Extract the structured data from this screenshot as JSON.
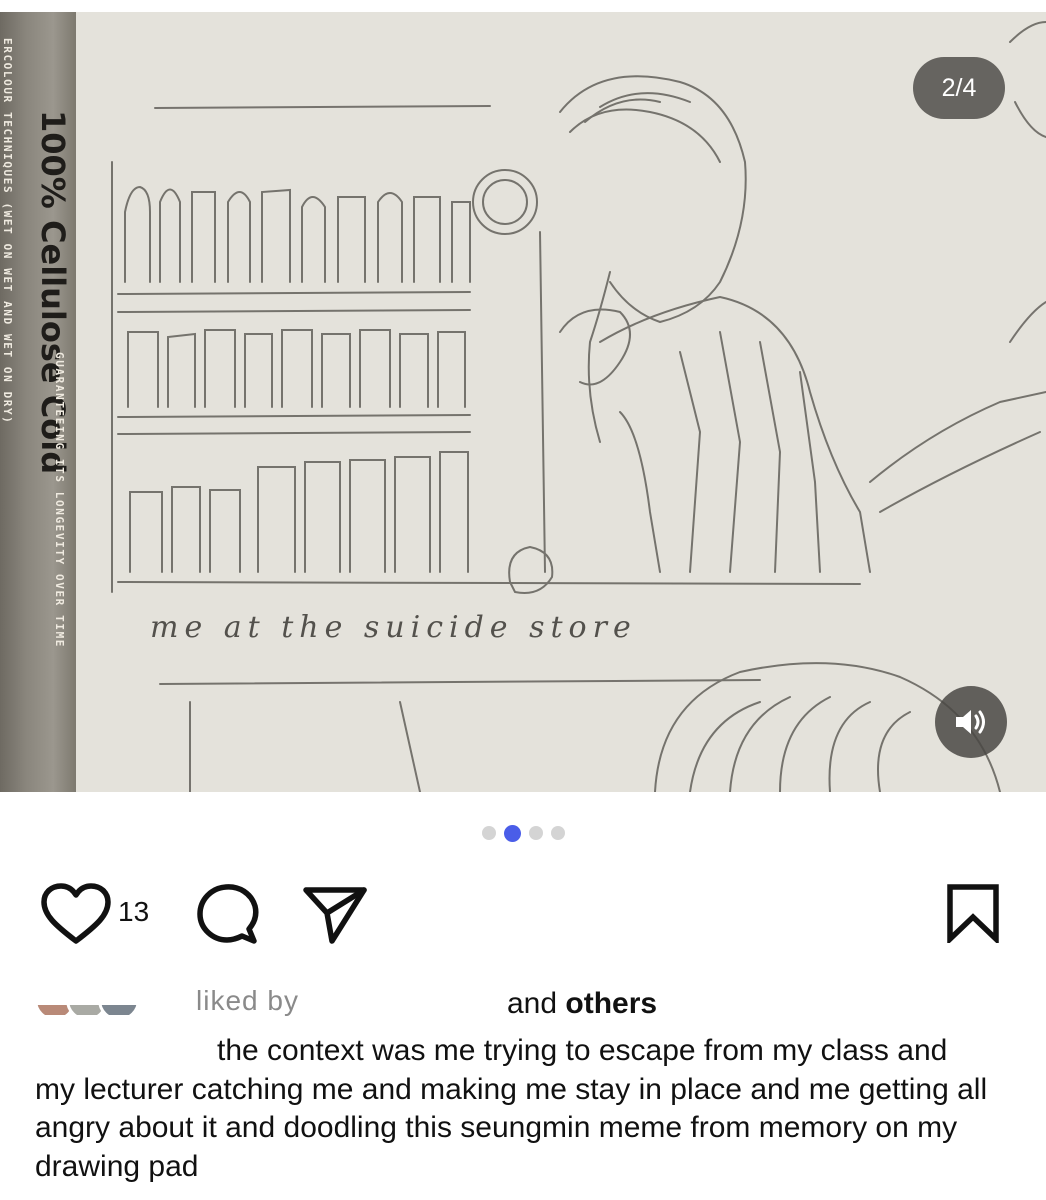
{
  "post": {
    "carousel_position": "2/4",
    "carousel_total": 4,
    "carousel_active_index": 1,
    "drawing_caption": "me at the suicide store",
    "book_spine": {
      "main_text": "100% Cellulose Cold",
      "sub_text_1": "ERCOLOUR TECHNIQUES (WET ON WET AND WET ON DRY)",
      "sub_text_2": "GUARANTEEING ITS LONGEVITY OVER TIME"
    }
  },
  "actions": {
    "like_count": "13",
    "like_icon": "heart-icon",
    "comment_icon": "comment-icon",
    "share_icon": "paper-plane-icon",
    "save_icon": "bookmark-icon",
    "sound_icon": "speaker-icon"
  },
  "likes": {
    "prefix": "liked by",
    "suffix_and": "and",
    "suffix_others": "others"
  },
  "caption": {
    "text": "the context was me trying to escape from my class and my lecturer catching me and making me stay in place and me getting all angry about it and doodling this seungmin meme from memory on my drawing pad"
  },
  "colors": {
    "accent_dot": "#4a5de8",
    "inactive_dot": "#d4d4d4",
    "overlay": "#4a4844"
  }
}
